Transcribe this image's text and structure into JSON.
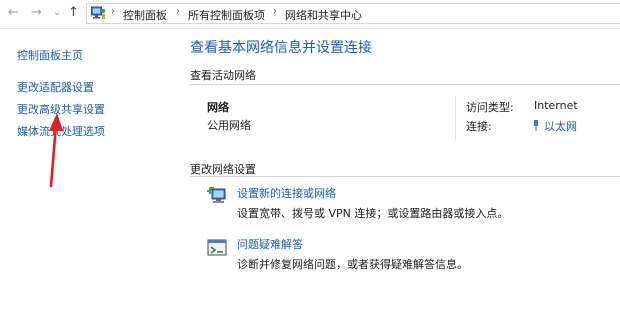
{
  "breadcrumb": {
    "items": [
      "控制面板",
      "所有控制面板项",
      "网络和共享中心"
    ],
    "separator": "›",
    "nav_back": "←",
    "nav_forward": "→",
    "nav_recent": "⌄",
    "nav_up": "↑"
  },
  "sidebar": {
    "items": [
      {
        "label": "控制面板主页"
      },
      {
        "label": "更改适配器设置"
      },
      {
        "label": "更改高级共享设置"
      },
      {
        "label": "媒体流式处理选项"
      }
    ]
  },
  "main": {
    "title": "查看基本网络信息并设置连接",
    "active_section": "查看活动网络",
    "network": {
      "name": "网络",
      "type": "公用网络",
      "access_label": "访问类型:",
      "access_value": "Internet",
      "conn_label": "连接:",
      "conn_value": "以太网"
    },
    "change_section": "更改网络设置",
    "tasks": [
      {
        "title": "设置新的连接或网络",
        "desc": "设置宽带、拨号或 VPN 连接；或设置路由器或接入点。",
        "icon": "new-connection-icon"
      },
      {
        "title": "问题疑难解答",
        "desc": "诊断并修复网络问题，或者获得疑难解答信息。",
        "icon": "troubleshoot-icon"
      }
    ]
  },
  "colors": {
    "link": "#1c5fb3",
    "title": "#1a5fb4",
    "annotation_arrow": "#e0201b"
  }
}
